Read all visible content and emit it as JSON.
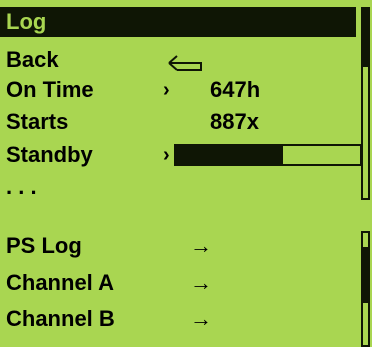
{
  "panel1": {
    "title": "Log",
    "items": [
      {
        "label": "Back",
        "icon": "return-arrow-icon"
      },
      {
        "label": "On Time",
        "chevron": "›",
        "value": "647h"
      },
      {
        "label": "Starts",
        "value": "887x"
      },
      {
        "label": "Standby",
        "chevron": "›",
        "progress_fraction": 0.58
      },
      {
        "label": ". . ."
      }
    ]
  },
  "panel2": {
    "items": [
      {
        "label": "PS Log",
        "arrow": "→"
      },
      {
        "label": "Channel A",
        "arrow": "→"
      },
      {
        "label": "Channel B",
        "arrow": "→"
      }
    ]
  },
  "colors": {
    "background": "#a9d651",
    "foreground": "#0f1605"
  }
}
